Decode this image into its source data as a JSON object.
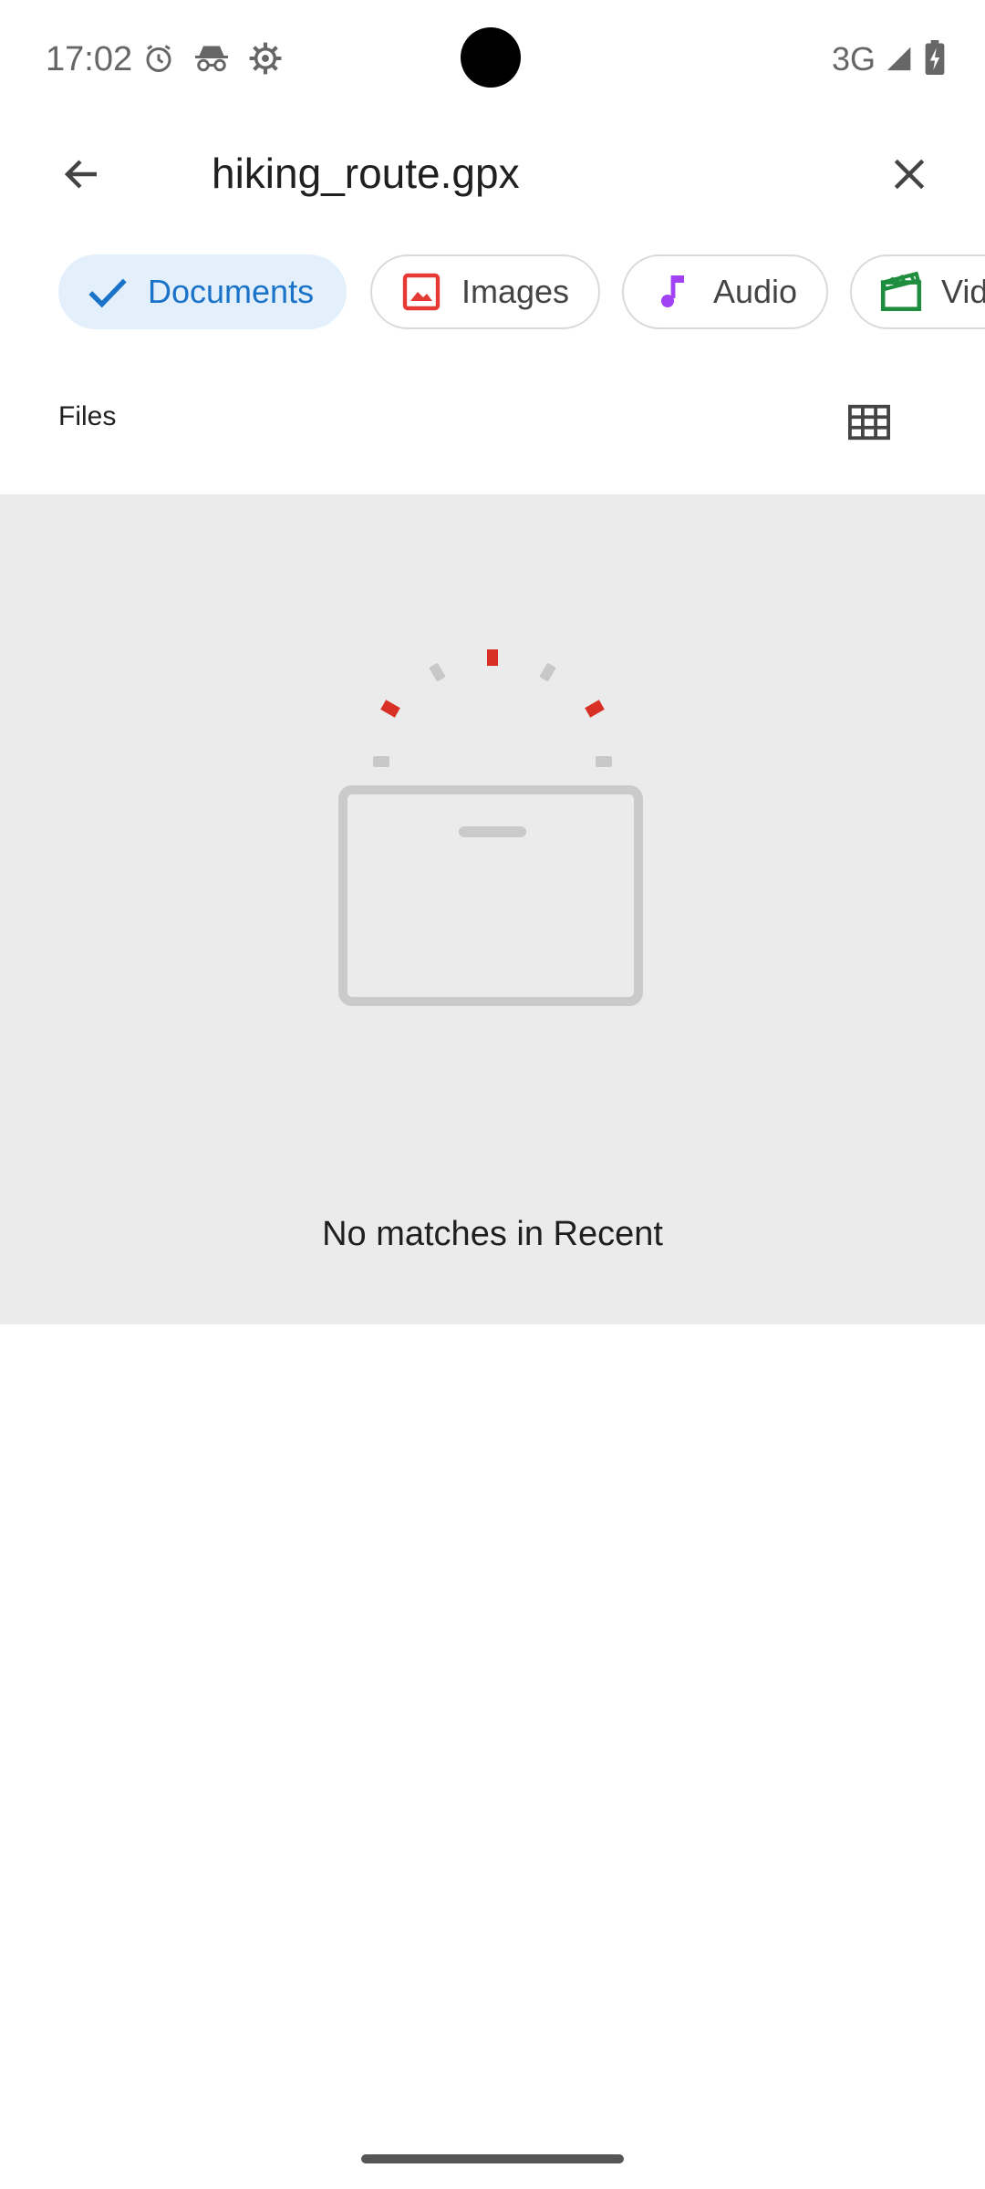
{
  "status_bar": {
    "time": "17:02",
    "icons": [
      "alarm-icon",
      "incognito-icon",
      "settings-icon"
    ],
    "network": "3G",
    "right_icons": [
      "signal-icon",
      "battery-charging-icon"
    ]
  },
  "top_bar": {
    "back_icon": "arrow-back-icon",
    "search_value": "hiking_route.gpx",
    "clear_icon": "close-icon"
  },
  "chips": {
    "documents": {
      "label": "Documents",
      "icon": "check-icon",
      "selected": true
    },
    "images": {
      "label": "Images",
      "icon": "image-icon"
    },
    "audio": {
      "label": "Audio",
      "icon": "music-note-icon"
    },
    "videos": {
      "label": "Videos",
      "icon": "movie-icon"
    }
  },
  "files": {
    "title": "Files",
    "view_toggle_icon": "grid-view-icon"
  },
  "empty_state": {
    "message": "No matches in Recent"
  },
  "colors": {
    "accent": "#1a73c8",
    "chip_selected_bg": "#e3f0fb",
    "empty_bg": "#ebebeb",
    "image_icon": "#e53935",
    "audio_icon": "#a142f4",
    "video_icon": "#1e8e3e"
  }
}
